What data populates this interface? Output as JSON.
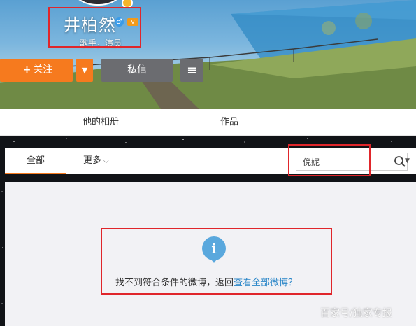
{
  "profile": {
    "name": "井柏然",
    "bio": "歌手，演员",
    "gender_icon": "male-icon",
    "vip_icon": "vip-badge-icon",
    "gender_glyph": "♂",
    "vip_glyph": "V"
  },
  "actions": {
    "follow_label": "关注",
    "follow_glyph": "+",
    "follow_dropdown_glyph": "▼",
    "message_label": "私信",
    "menu_glyph": "≡"
  },
  "tabs": [
    {
      "label": "他的相册"
    },
    {
      "label": "作品"
    }
  ],
  "filter": {
    "all_label": "全部",
    "more_label": "更多",
    "more_glyph": "⌵",
    "search_value": "倪妮",
    "search_drop_glyph": "▼"
  },
  "empty_state": {
    "icon_glyph": "i",
    "message": "找不到符合条件的微博，返回",
    "link_text": "查看全部微博？"
  },
  "watermark": "百家号/独家专报",
  "colors": {
    "accent_orange": "#f67a1e",
    "highlight_red": "#e0262b",
    "link_blue": "#2a86c8",
    "info_blue": "#5aa8dd"
  }
}
